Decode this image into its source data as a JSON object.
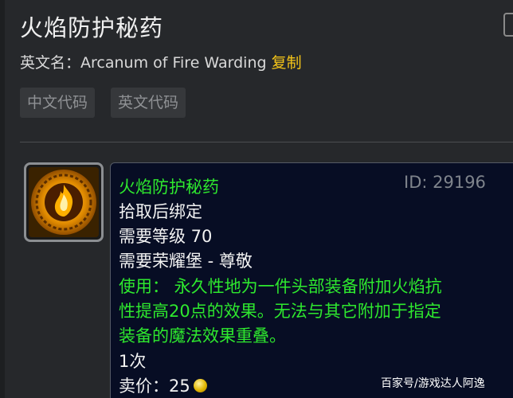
{
  "item": {
    "title": "火焰防护秘药",
    "english_label": "英文名：",
    "english_name": "Arcanum of Fire Warding",
    "copy_label": "复制",
    "buttons": {
      "cn_code": "中文代码",
      "en_code": "英文代码"
    }
  },
  "tooltip": {
    "name": "火焰防护秘药",
    "id": "ID: 29196",
    "bind": "拾取后绑定",
    "level_req": "需要等级 70",
    "rep_req": "需要荣耀堡 - 尊敬",
    "use_lines": [
      "使用：   永久性地为一件头部装备附加火焰抗",
      "性提高20点的效果。无法与其它附加于指定",
      "装备的魔法效果重叠。"
    ],
    "count": "1次",
    "sell_label": "卖价：",
    "sell_value": "25",
    "coin_icon": "gold-coin-icon"
  },
  "watermark": "百家号/游戏达人阿逸",
  "colors": {
    "name_green": "#2ee82e",
    "copy_yellow": "#f5c518",
    "tooltip_bg": "#070d24",
    "page_bg": "#26282b"
  }
}
